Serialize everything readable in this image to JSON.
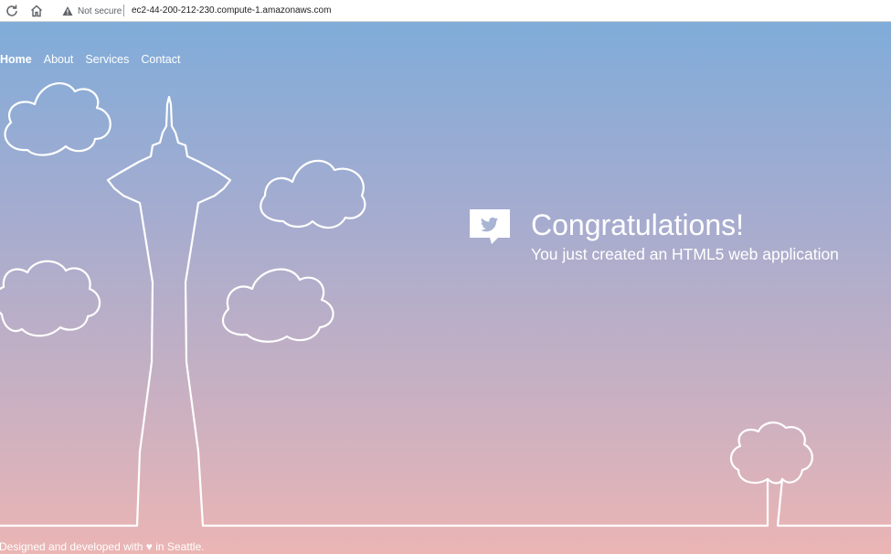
{
  "browser": {
    "security_label": "Not secure",
    "url": "ec2-44-200-212-230.compute-1.amazonaws.com",
    "reload_icon": "reload-icon",
    "home_icon": "home-icon",
    "warning_icon": "warning-icon"
  },
  "nav": {
    "items": [
      {
        "label": "Home",
        "active": true
      },
      {
        "label": "About",
        "active": false
      },
      {
        "label": "Services",
        "active": false
      },
      {
        "label": "Contact",
        "active": false
      }
    ]
  },
  "hero": {
    "title": "Congratulations!",
    "subtitle": "You just created an HTML5 web application",
    "icon": "twitter-bird-speech-bubble-icon"
  },
  "footer": {
    "text_before": "Designed and developed with ",
    "heart": "♥",
    "text_after": " in Seattle."
  },
  "colors": {
    "gradient_top": "#80acd9",
    "gradient_bottom": "#ebb5b4",
    "line": "#ffffff"
  }
}
